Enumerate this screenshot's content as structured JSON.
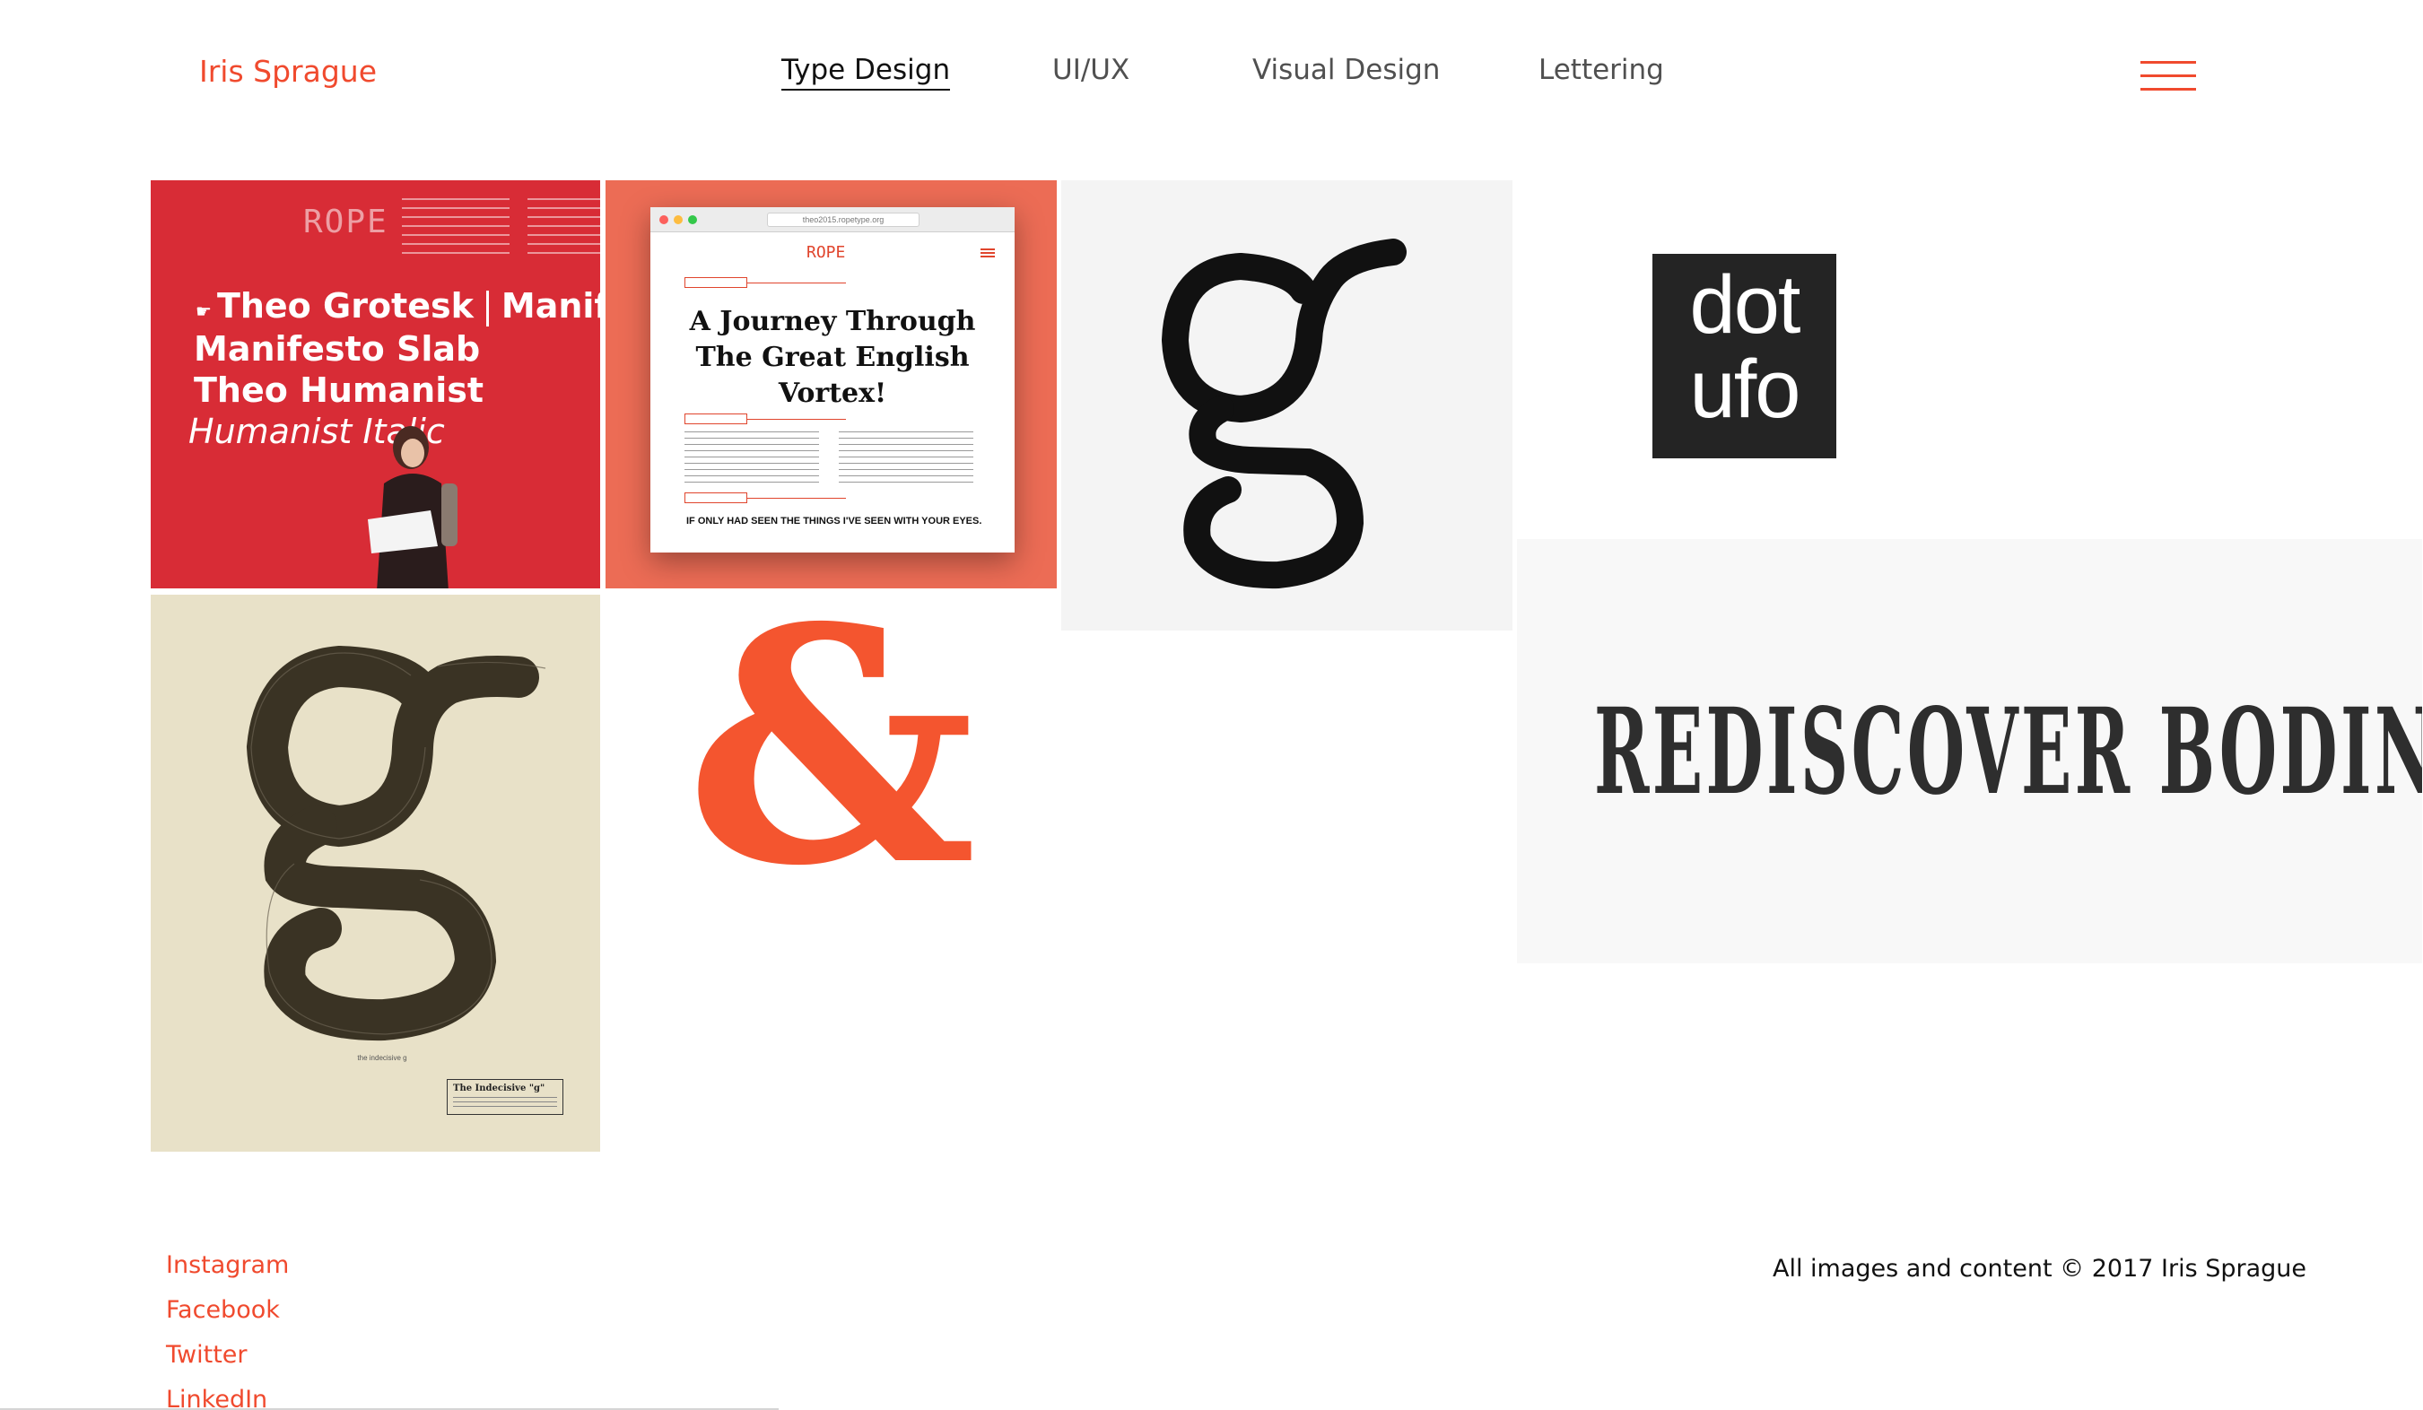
{
  "site": {
    "brand": "Iris Sprague"
  },
  "nav": {
    "items": [
      {
        "label": "Type Design",
        "active": true
      },
      {
        "label": "UI/UX",
        "active": false
      },
      {
        "label": "Visual Design",
        "active": false
      },
      {
        "label": "Lettering",
        "active": false
      }
    ],
    "menu_icon": "hamburger-menu-icon"
  },
  "projects": {
    "rope": {
      "logo": "ROPE",
      "line1_a": "Theo Grotesk",
      "line1_b": "Manifesto",
      "line2": "Manifesto Slab",
      "line3": "Theo Humanist",
      "line4": "Humanist Italic"
    },
    "website": {
      "url": "theo2015.ropetype.org",
      "logo": "ROPE",
      "title_line1": "A Journey Through",
      "title_line2": "The Great English",
      "title_line3": "Vortex!",
      "caption": "IF ONLY HAD SEEN THE THINGS I'VE SEEN WITH YOUR EYES."
    },
    "g_letter": {
      "glyph": "g"
    },
    "dotufo": {
      "line1": "dot",
      "line2": "ufo"
    },
    "poster": {
      "caption": "the indecisive g",
      "box_title": "The Indecisive \"g\""
    },
    "ampersand": {
      "glyph": "&"
    },
    "bodoni": {
      "text": "REDISCOVER BODINI"
    }
  },
  "footer": {
    "social": [
      "Instagram",
      "Facebook",
      "Twitter",
      "LinkedIn"
    ],
    "copyright": "All images and content © 2017 Iris Sprague"
  },
  "colors": {
    "accent": "#f04a2e",
    "rope_red": "#d82c36",
    "website_bg": "#ec6c55",
    "ampersand": "#f4552f",
    "poster_bg": "#e8e1c8"
  }
}
